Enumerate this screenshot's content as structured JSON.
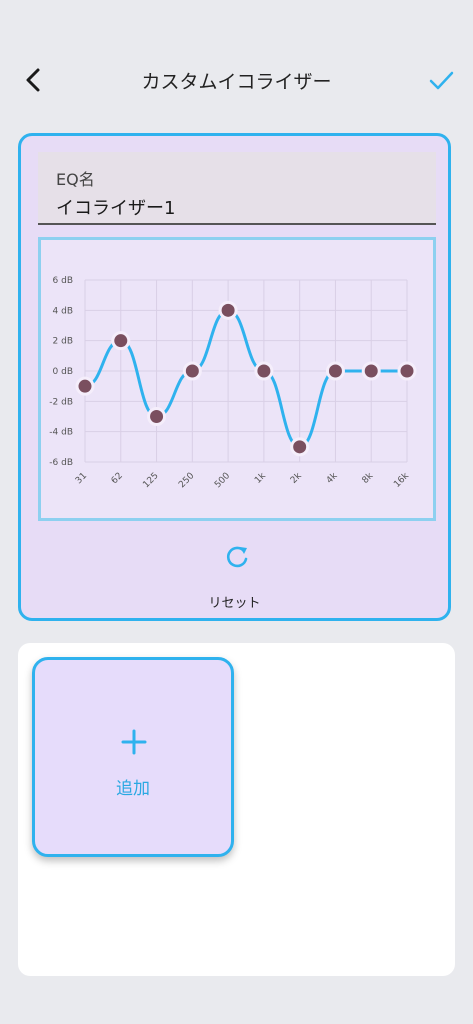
{
  "header": {
    "title": "カスタムイコライザー",
    "back_icon": "chevron-left-icon",
    "confirm_icon": "check-icon"
  },
  "eq": {
    "name_label": "EQ名",
    "name_value": "イコライザー1",
    "reset_label": "リセット",
    "reset_icon": "refresh-icon"
  },
  "chart_data": {
    "type": "line",
    "categories": [
      "31",
      "62",
      "125",
      "250",
      "500",
      "1k",
      "2k",
      "4k",
      "8k",
      "16k"
    ],
    "values": [
      -1,
      2,
      -3,
      0,
      4,
      0,
      -5,
      0,
      0,
      0
    ],
    "y_ticks": [
      "6 dB",
      "4 dB",
      "2 dB",
      "0 dB",
      "-2 dB",
      "-4 dB",
      "-6 dB"
    ],
    "ylim": [
      -6,
      6
    ],
    "grid": true,
    "line_color": "#2fb2ee",
    "point_color": "#7a4f5f"
  },
  "presets": {
    "add_label": "追加",
    "add_icon": "plus-icon"
  },
  "colors": {
    "accent": "#2fb2ee",
    "card_bg": "#e7dcf6",
    "page_bg": "#e9eaee"
  }
}
